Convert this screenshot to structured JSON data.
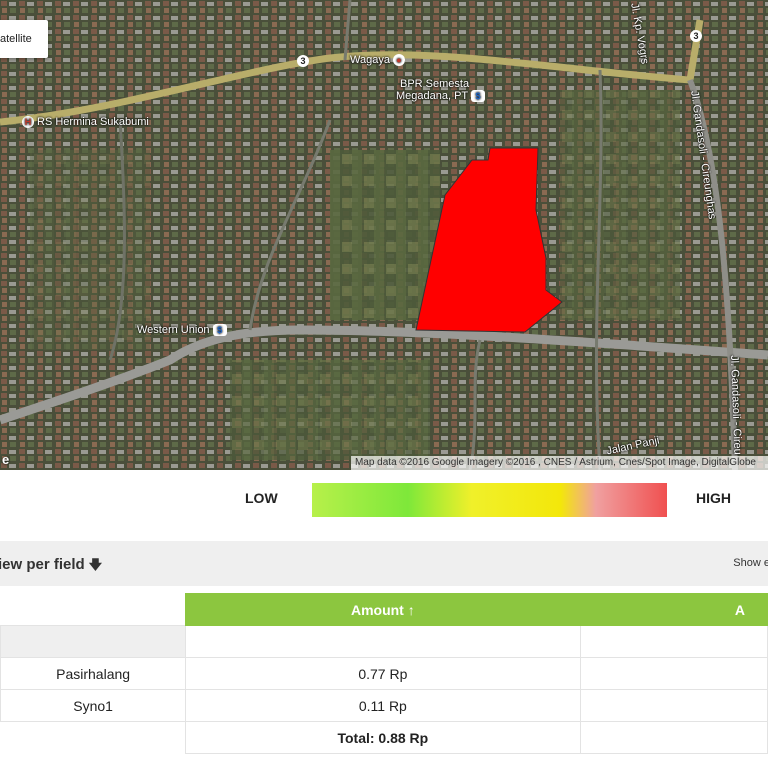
{
  "map": {
    "type_button": "atellite",
    "labels": {
      "wagaya": "Wagaya",
      "bpr": "BPR Semesta",
      "bpr2": "Megadana, PT",
      "hermina": "RS Hermina Sukabumi",
      "western_union": "Western Union",
      "kp_vogrs": "Jl. Kp. Vogrs",
      "gandasoli_1": "Jl. Gandasoli - Cireunghas",
      "gandasoli_2": "Jl. Gandasoli - Cireu",
      "jalan_panji": "Jalan Panji",
      "route_shield": "3"
    },
    "google_fragment": "e",
    "attribution": "Map data ©2016 Google Imagery ©2016 , CNES / Astrium, Cnes/Spot Image, DigitalGlobe",
    "field_color": "#ff0000"
  },
  "legend": {
    "low": "LOW",
    "high": "HIGH"
  },
  "section": {
    "title": "iew per field",
    "title_icon": "arrow-down-icon",
    "show_entries": "Show e"
  },
  "table": {
    "header": {
      "amount": "Amount ↑",
      "next_col": "A"
    },
    "rows": [
      {
        "name": "Pasirhalang",
        "amount": "0.77 Rp",
        "extra": ""
      },
      {
        "name": "Syno1",
        "amount": "0.11 Rp",
        "extra": ""
      }
    ],
    "total": "Total: 0.88 Rp"
  }
}
